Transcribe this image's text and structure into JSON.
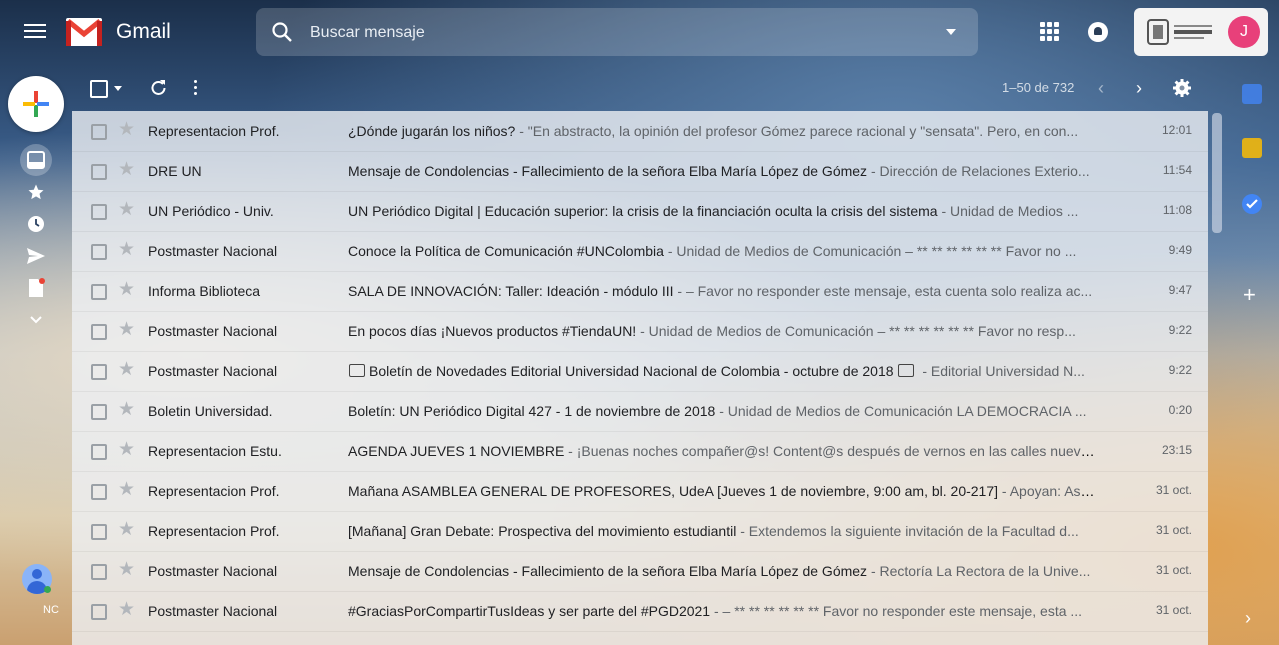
{
  "header": {
    "app_title": "Gmail",
    "search_placeholder": "Buscar mensaje",
    "account_initial": "J"
  },
  "toolbar": {
    "page_count": "1–50 de 732"
  },
  "rail": {
    "account_label": "NC"
  },
  "emails": [
    {
      "sender": "Representacion Prof.",
      "subject": "¿Dónde jugarán los niños?",
      "snippet": " - \"En abstracto, la opinión del profesor Gómez parece racional y \"sensata\". Pero, en con...",
      "time": "12:01"
    },
    {
      "sender": "DRE UN",
      "subject": "Mensaje de Condolencias - Fallecimiento de la señora Elba María López de Gómez",
      "snippet": " - Dirección de Relaciones Exterio...",
      "time": "11:54"
    },
    {
      "sender": "UN Periódico - Univ.",
      "subject": "UN Periódico Digital | Educación superior: la crisis de la financiación oculta la crisis del sistema",
      "snippet": " - Unidad de Medios ...",
      "time": "11:08"
    },
    {
      "sender": "Postmaster Nacional",
      "subject": "Conoce la Política de Comunicación #UNColombia",
      "snippet": " - Unidad de Medios de Comunicación – ** ** ** ** ** ** Favor no ...",
      "time": "9:49"
    },
    {
      "sender": "Informa Biblioteca",
      "subject": "SALA DE INNOVACIÓN: Taller: Ideación - módulo III",
      "snippet": " - – Favor no responder este mensaje, esta cuenta solo realiza ac...",
      "time": "9:47"
    },
    {
      "sender": "Postmaster Nacional",
      "subject": "En pocos días ¡Nuevos productos #TiendaUN!",
      "snippet": " - Unidad de Medios de Comunicación – ** ** ** ** ** ** Favor no resp...",
      "time": "9:22"
    },
    {
      "sender": "Postmaster Nacional",
      "subject_pre": "",
      "subject": "Boletín de Novedades Editorial Universidad Nacional de Colombia - octubre de 2018",
      "snippet": " - Editorial Universidad N...",
      "time": "9:22",
      "boxes": true
    },
    {
      "sender": "Boletin Universidad.",
      "subject": "Boletín: UN Periódico Digital 427 - 1 de noviembre de 2018",
      "snippet": " - Unidad de Medios de Comunicación LA DEMOCRACIA ...",
      "time": "0:20"
    },
    {
      "sender": "Representacion Estu.",
      "subject": "AGENDA JUEVES 1 NOVIEMBRE",
      "snippet": " - ¡Buenas noches compañer@s! Content@s después de vernos en las calles nueva...",
      "time": "23:15"
    },
    {
      "sender": "Representacion Prof.",
      "subject": "Mañana ASAMBLEA GENERAL DE PROFESORES, UdeA [Jueves 1 de noviembre, 9:00 am, bl. 20-217]",
      "snippet": " - Apoyan: Asopr...",
      "time": "31 oct."
    },
    {
      "sender": "Representacion Prof.",
      "subject": "[Mañana] Gran Debate: Prospectiva del movimiento estudiantil",
      "snippet": " - Extendemos la siguiente invitación de la Facultad d...",
      "time": "31 oct."
    },
    {
      "sender": "Postmaster Nacional",
      "subject": "Mensaje de Condolencias - Fallecimiento de la señora Elba María López de Gómez",
      "snippet": " - Rectoría La Rectora de la Unive...",
      "time": "31 oct."
    },
    {
      "sender": "Postmaster Nacional",
      "subject": "#GraciasPorCompartirTusIdeas y ser parte del #PGD2021",
      "snippet": " - – ** ** ** ** ** ** Favor no responder este mensaje, esta ...",
      "time": "31 oct."
    }
  ],
  "icons": {
    "menu": "hamburger-icon",
    "search": "search-icon",
    "apps": "apps-grid-icon",
    "notifications": "notifications-icon",
    "compose": "compose-plus-icon",
    "inbox": "inbox-icon",
    "starred": "star-icon",
    "snoozed": "clock-icon",
    "sent": "send-icon",
    "drafts": "draft-icon",
    "more": "chevron-down-icon",
    "refresh": "refresh-icon",
    "settings": "gear-icon"
  },
  "colors": {
    "gmail_red": "#ea4335",
    "avatar_pink": "#e8407a",
    "calendar_blue": "#4285f4",
    "keep_yellow": "#fbbc04",
    "draft_badge": "#ea4335"
  }
}
